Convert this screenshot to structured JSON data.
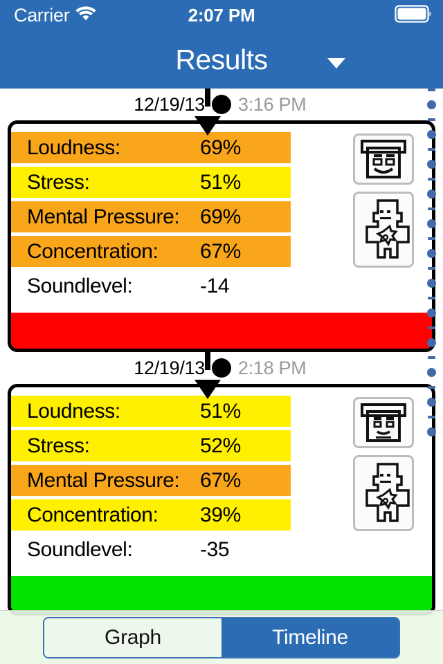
{
  "status_bar": {
    "carrier": "Carrier",
    "wifi_icon": "wifi-icon",
    "time": "2:07 PM",
    "battery_icon": "battery-icon"
  },
  "nav_bar": {
    "title": "Results",
    "caret_icon": "chevron-down-icon"
  },
  "theme": {
    "accent_blue": "#2C6CB4",
    "rail_blue": "#4269A8",
    "orange": "#FAA61A",
    "yellow": "#FFF000",
    "red": "#FF0000",
    "green": "#00E400",
    "tabbar_bg": "#EAF8E7"
  },
  "entries": [
    {
      "date": "12/19/13",
      "time": "3:16 PM",
      "face_icon": "smiley-face-icon",
      "body_icon": "body-stress-icon",
      "status_color": "#FF0000",
      "metrics": [
        {
          "label": "Loudness:",
          "value": "69%",
          "color": "#FAA61A"
        },
        {
          "label": "Stress:",
          "value": "51%",
          "color": "#FFF000"
        },
        {
          "label": "Mental Pressure:",
          "value": "69%",
          "color": "#FAA61A"
        },
        {
          "label": "Concentration:",
          "value": "67%",
          "color": "#FAA61A"
        },
        {
          "label": "Soundlevel:",
          "value": "-14",
          "color": "transparent"
        }
      ]
    },
    {
      "date": "12/19/13",
      "time": "2:18 PM",
      "face_icon": "neutral-face-icon",
      "body_icon": "body-stress-icon",
      "status_color": "#00E400",
      "metrics": [
        {
          "label": "Loudness:",
          "value": "51%",
          "color": "#FFF000"
        },
        {
          "label": "Stress:",
          "value": "52%",
          "color": "#FFF000"
        },
        {
          "label": "Mental Pressure:",
          "value": "67%",
          "color": "#FAA61A"
        },
        {
          "label": "Concentration:",
          "value": "39%",
          "color": "#FFF000"
        },
        {
          "label": "Soundlevel:",
          "value": "-35",
          "color": "transparent"
        }
      ]
    }
  ],
  "tab_bar": {
    "segments": [
      {
        "label": "Graph",
        "selected": false
      },
      {
        "label": "Timeline",
        "selected": true
      }
    ]
  }
}
